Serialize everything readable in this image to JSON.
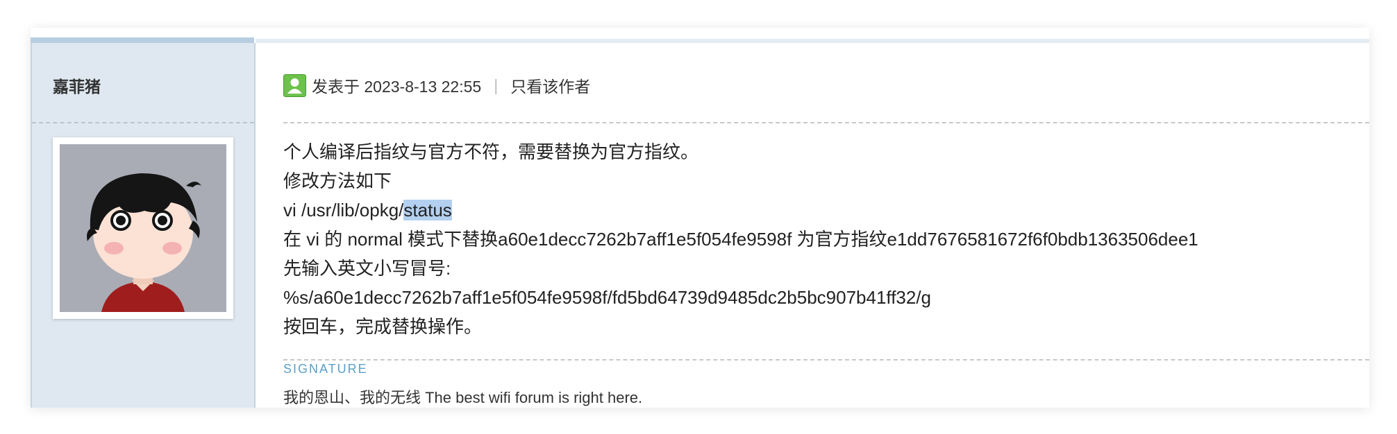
{
  "author": {
    "name": "嘉菲猪",
    "avatar": "cartoon-boy-avatar"
  },
  "post_meta": {
    "status_icon": "online-user-icon",
    "posted": "发表于 2023-8-13 22:55",
    "separator": "|",
    "only_author_link": "只看该作者"
  },
  "post_body": {
    "lines": [
      "个人编译后指纹与官方不符，需要替换为官方指纹。",
      "修改方法如下",
      "vi /usr/lib/opkg/",
      "在 vi 的 normal 模式下替换a60e1decc7262b7aff1e5f054fe9598f 为官方指纹e1dd7676581672f6f0bdb1363506dee1",
      "先输入英文小写冒号:",
      "%s/a60e1decc7262b7aff1e5f054fe9598f/fd5bd64739d9485dc2b5bc907b41ff32/g",
      "按回车，完成替换操作。"
    ],
    "selected_text": "status"
  },
  "signature": {
    "label": "SIGNATURE",
    "text": "我的恩山、我的无线 The best wifi forum is right here."
  },
  "colors": {
    "sidebar_bg": "#dfe8f0",
    "signature_label": "#5aa0c8",
    "selection": "#b4d0f0"
  }
}
